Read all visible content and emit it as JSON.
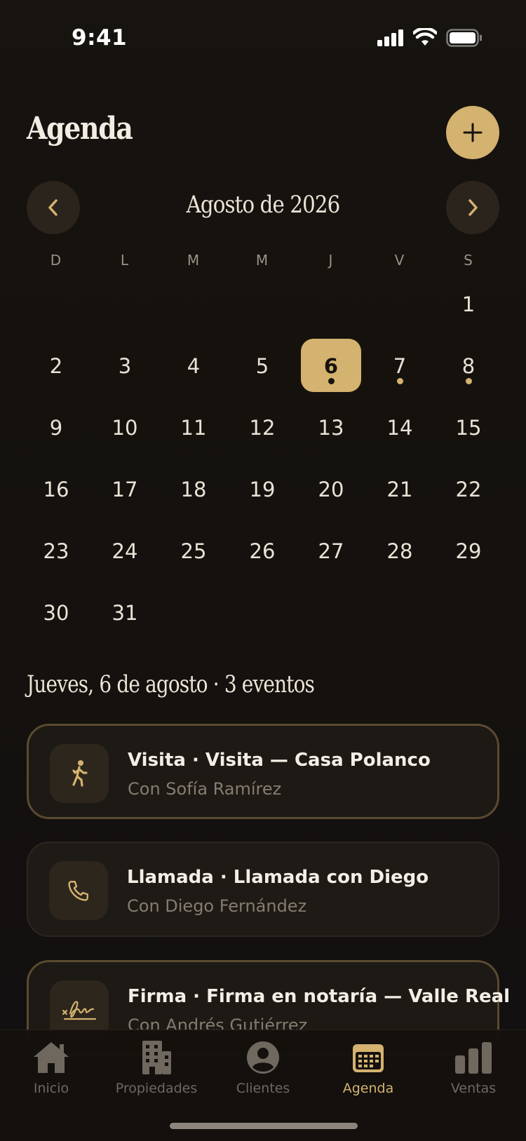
{
  "status_bar": {
    "time": "9:41"
  },
  "header": {
    "title": "Agenda",
    "add_icon": "plus-icon"
  },
  "calendar": {
    "month_label": "Agosto de 2026",
    "weekdays": [
      "D",
      "L",
      "M",
      "M",
      "J",
      "V",
      "S"
    ],
    "leading_blank_days": 6,
    "selected_day": 6,
    "days": [
      "1",
      "2",
      "3",
      "4",
      "5",
      "6",
      "7",
      "8",
      "9",
      "10",
      "11",
      "12",
      "13",
      "14",
      "15",
      "16",
      "17",
      "18",
      "19",
      "20",
      "21",
      "22",
      "23",
      "24",
      "25",
      "26",
      "27",
      "28",
      "29",
      "30",
      "31"
    ],
    "days_with_events": [
      6,
      7,
      8
    ]
  },
  "section": {
    "title": "Jueves, 6 de agosto · 3 eventos"
  },
  "events": [
    {
      "title": "Visita · Visita — Casa Polanco",
      "subtitle": "Con Sofía Ramírez",
      "icon": "walking-icon"
    },
    {
      "title": "Llamada · Llamada con Diego",
      "subtitle": "Con Diego Fernández",
      "icon": "phone-icon"
    },
    {
      "title": "Firma · Firma en notaría — Valle Real",
      "subtitle": "Con Andrés Gutiérrez",
      "icon": "signature-icon"
    }
  ],
  "tabbar": {
    "tabs": [
      {
        "label": "Inicio",
        "icon": "home-icon"
      },
      {
        "label": "Propiedades",
        "icon": "building-icon"
      },
      {
        "label": "Clientes",
        "icon": "user-icon"
      },
      {
        "label": "Agenda",
        "icon": "calendar-icon"
      },
      {
        "label": "Ventas",
        "icon": "bar-chart-icon"
      }
    ],
    "active_tab": "Agenda"
  },
  "colors": {
    "accent": "#d4b26f",
    "background": "#14110e",
    "card": "#1e1a15"
  }
}
